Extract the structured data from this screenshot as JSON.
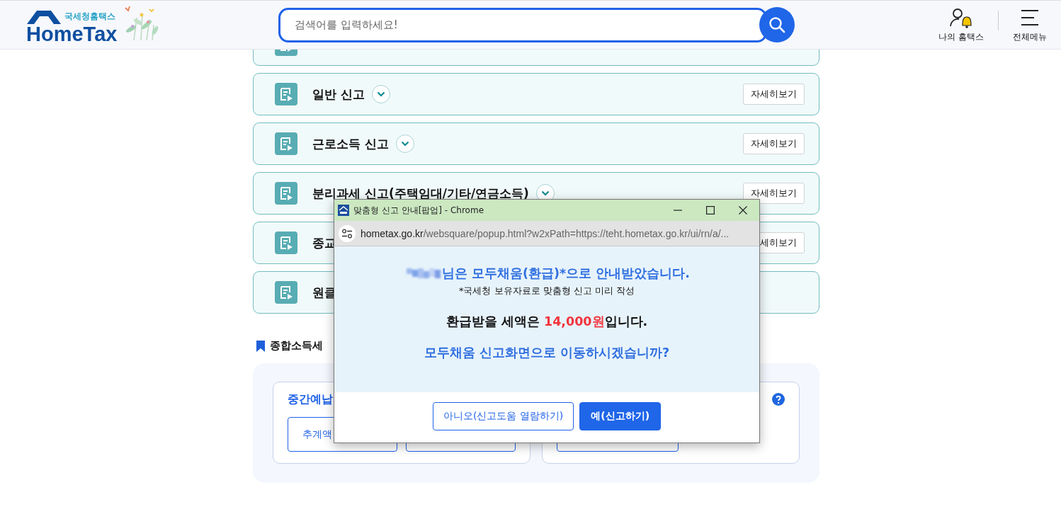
{
  "header": {
    "logo_small": "국세청홈택스",
    "logo_big": "HomeTax",
    "search": {
      "placeholder": "검색어를 입력하세요!"
    },
    "nav": [
      {
        "kind": "user",
        "label": "나의 홈택스"
      },
      {
        "kind": "menu",
        "label": "전체메뉴"
      }
    ]
  },
  "cards": [
    {
      "has_chevron": false
    },
    {
      "title": "일반 신고",
      "has_chevron": true,
      "button": "자세히보기"
    },
    {
      "title": "근로소득 신고",
      "has_chevron": true,
      "button": "자세히보기"
    },
    {
      "title": "분리과세 신고(주택임대/기타/연금소득)",
      "has_chevron": true,
      "button": "자세히보기"
    },
    {
      "title": "종교",
      "has_chevron": false,
      "button": "세히보기"
    },
    {
      "title": "원클",
      "has_chevron": false
    }
  ],
  "section": {
    "title": "종합소득세",
    "panels": [
      {
        "title": "중간예납",
        "buttons": [
          {
            "label": "추계액",
            "covered": false
          },
          {
            "covered": true
          }
        ]
      },
      {
        "help": true,
        "buttons": [
          {
            "covered": true
          }
        ]
      }
    ]
  },
  "popup": {
    "title": "맞춤형 신고 안내[팝업] - Chrome",
    "url_host": "hometax.go.kr",
    "url_path": "/websquare/popup.html?w2xPath=https://teht.hometax.go.kr/ui/rn/a/...",
    "greeting": "님은 모두채움(환급)*으로 안내받았습니다.",
    "note": "*국세청 보유자료로 맞춤형 신고 미리 작성",
    "amount_before": "환급받을 세액은 ",
    "amount": "14,000원",
    "amount_after": "입니다.",
    "question": "모두채움 신고화면으로 이동하시겠습니까?",
    "buttons": [
      {
        "label": "아니오(신고도움 열람하기)",
        "primary": false
      },
      {
        "label": "예(신고하기)",
        "primary": true
      }
    ]
  }
}
